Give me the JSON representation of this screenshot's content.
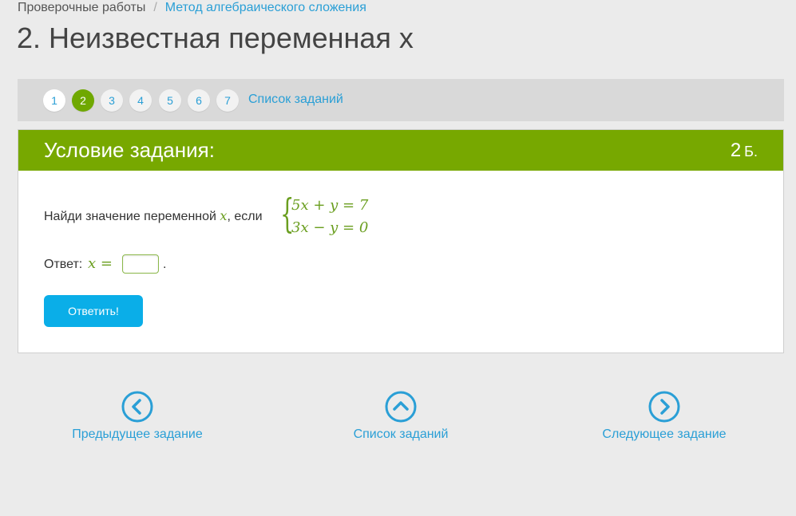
{
  "breadcrumb": {
    "root": "Проверочные работы",
    "separator": "/",
    "current": "Метод алгебраического сложения"
  },
  "page_title": "2. Неизвестная переменная x",
  "pager": {
    "pages": [
      "1",
      "2",
      "3",
      "4",
      "5",
      "6",
      "7"
    ],
    "active_page": "2",
    "list_label": "Список заданий"
  },
  "card": {
    "header_title": "Условие задания:",
    "points_value": "2",
    "points_unit": "Б.",
    "question_text": "Найди значение переменной",
    "question_var": "x",
    "question_suffix": ", если",
    "equation_1": "5x + y = 7",
    "equation_2": "3x − y = 0",
    "answer_label": "Ответ:",
    "answer_var": "x =",
    "answer_value": "",
    "answer_end": ".",
    "submit_label": "Ответить!"
  },
  "bottom_nav": {
    "prev_label": "Предыдущее задание",
    "list_label": "Список заданий",
    "next_label": "Следующее задание"
  },
  "colors": {
    "accent_green": "#77a800",
    "link_blue": "#2a9fd6",
    "button_blue": "#0aaee8",
    "background": "#ebebeb"
  },
  "icons": {
    "prev": "chevron-left-circle-icon",
    "list": "chevron-up-circle-icon",
    "next": "chevron-right-circle-icon"
  }
}
